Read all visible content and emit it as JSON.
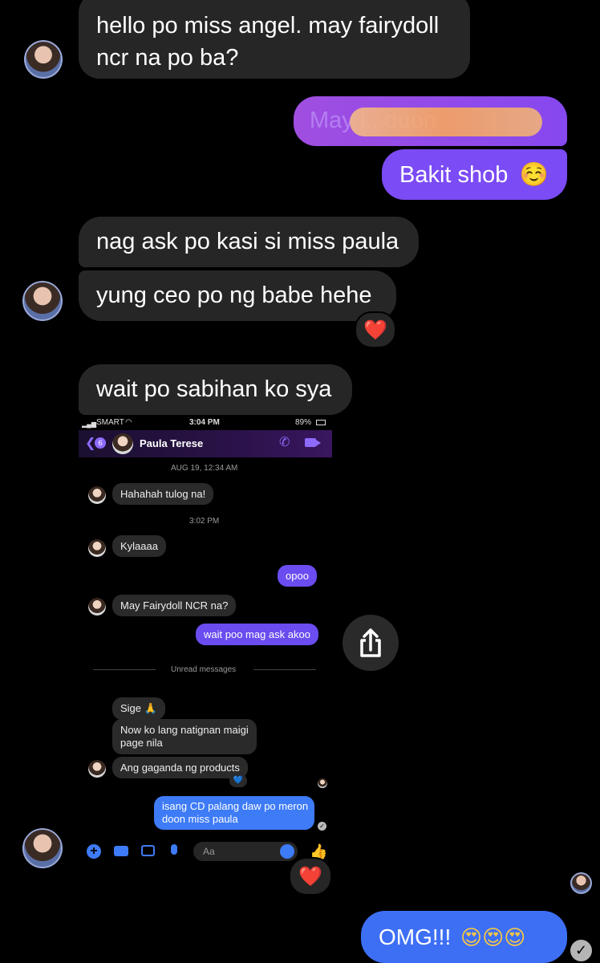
{
  "messages": {
    "m1_line1": "hello po miss angel. may fairydoll",
    "m1_line2": "ncr na po ba?",
    "m2_obscured": "May i...duon",
    "m3_text": "Bakit shob",
    "m3_emoji": "☺️",
    "m4": "nag ask po kasi si miss paula",
    "m5": "yung ceo po ng babe hehe",
    "m5_reaction": "❤️",
    "m6": "wait po sabihan ko sya",
    "screenshot_reaction": "❤️",
    "final_text": "OMG!!!",
    "final_emoji": "😍😍😍",
    "seen_icon": "check-circle-icon"
  },
  "screenshot": {
    "status": {
      "carrier": "SMART",
      "time": "3:04 PM",
      "battery": "89%"
    },
    "header": {
      "back_count": "6",
      "contact_name": "Paula Terese"
    },
    "date_divider": "AUG 19, 12:34 AM",
    "msg_a": "Hahahah tulog na!",
    "time_divider": "3:02 PM",
    "msg_b": "Kylaaaa",
    "msg_c": "opoo",
    "msg_d": "May Fairydoll NCR na?",
    "msg_e": "wait poo mag ask akoo",
    "unread_label": "Unread messages",
    "msg_f": "Sige 🙏",
    "msg_g_line1": "Now ko lang natignan maigi",
    "msg_g_line2": "page nila",
    "msg_h": "Ang gaganda ng products",
    "msg_h_reaction": "💙",
    "msg_i_line1": "isang CD palang daw po meron",
    "msg_i_line2": "doon miss paula",
    "composer_placeholder": "Aa"
  },
  "colors": {
    "background": "#000000",
    "incoming": "#262626",
    "outgoing": "#7b4bf5",
    "outgoing_blue": "#3e7bf7"
  }
}
